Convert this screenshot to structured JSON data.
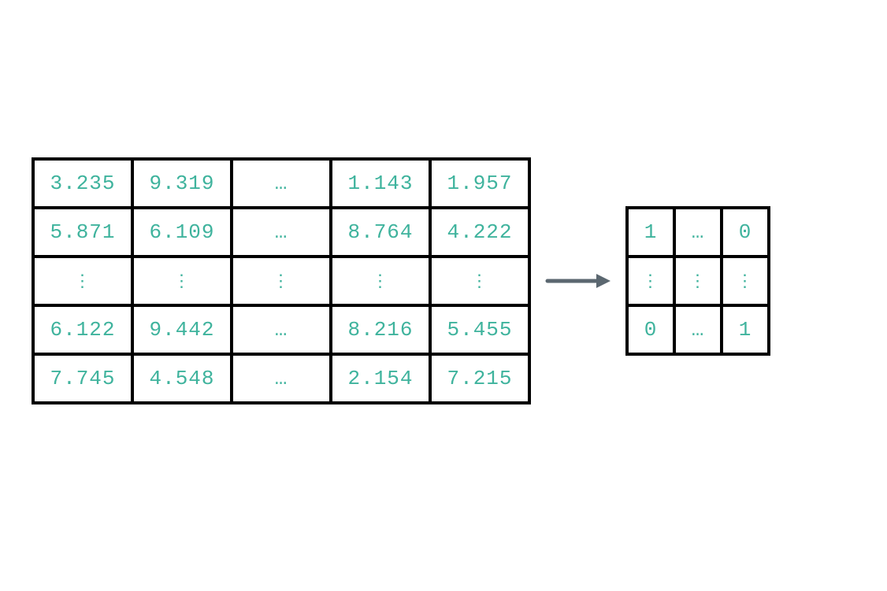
{
  "glyphs": {
    "hdots": "…",
    "vdots": "⋮"
  },
  "arrow": {
    "color": "#5b6770"
  },
  "big_matrix": {
    "rows": [
      [
        "3.235",
        "9.319",
        "…",
        "1.143",
        "1.957"
      ],
      [
        "5.871",
        "6.109",
        "…",
        "8.764",
        "4.222"
      ],
      [
        "⋮",
        "⋮",
        "⋮",
        "⋮",
        "⋮"
      ],
      [
        "6.122",
        "9.442",
        "…",
        "8.216",
        "5.455"
      ],
      [
        "7.745",
        "4.548",
        "…",
        "2.154",
        "7.215"
      ]
    ]
  },
  "small_matrix": {
    "rows": [
      [
        "1",
        "…",
        "0"
      ],
      [
        "⋮",
        "⋮",
        "⋮"
      ],
      [
        "0",
        "…",
        "1"
      ]
    ]
  }
}
